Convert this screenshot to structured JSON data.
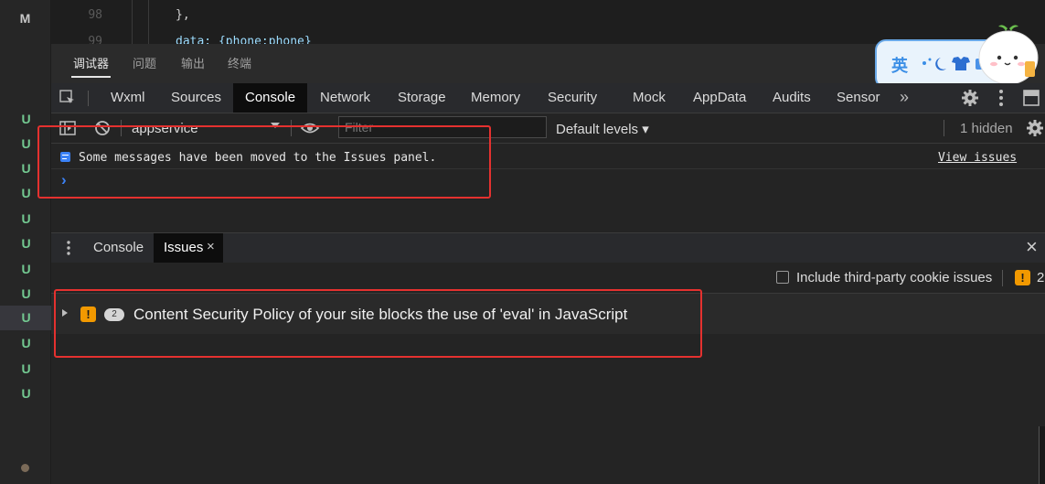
{
  "gutter": {
    "top_letter": "M",
    "u_labels": [
      "U",
      "U",
      "U",
      "U",
      "U",
      "U",
      "U",
      "U",
      "U",
      "U",
      "U",
      "U"
    ]
  },
  "editor": {
    "line_98": "98",
    "line_98_code": "},",
    "line_99": "99",
    "line_99_code": "data: {phone:phone}"
  },
  "panel_tabs": [
    "调试器",
    "问题",
    "输出",
    "终端"
  ],
  "dev_tabs": [
    "Wxml",
    "Sources",
    "Console",
    "Network",
    "Storage",
    "Memory",
    "Security",
    "Mock",
    "AppData",
    "Audits",
    "Sensor"
  ],
  "more_tabs": "»",
  "console_toolbar": {
    "context": "appservice",
    "filter_placeholder": "Filter",
    "levels": "Default levels ▾",
    "hidden": "1 hidden"
  },
  "messages": {
    "info": "Some messages have been moved to the Issues panel.",
    "view_issues": "View issues",
    "prompt": "›"
  },
  "drawer": {
    "tabs": [
      "Console",
      "Issues"
    ],
    "close": "×"
  },
  "issues": {
    "third_party_label": "Include third-party cookie issues",
    "count_badge": "2",
    "issue_count": "2",
    "issue_title": "Content Security Policy of your site blocks the use of 'eval' in JavaScript"
  },
  "ime": {
    "label": "英"
  },
  "colors": {
    "accent_warning": "#f29900",
    "annotation_red": "#e5312f",
    "git_untracked": "#73c991"
  }
}
